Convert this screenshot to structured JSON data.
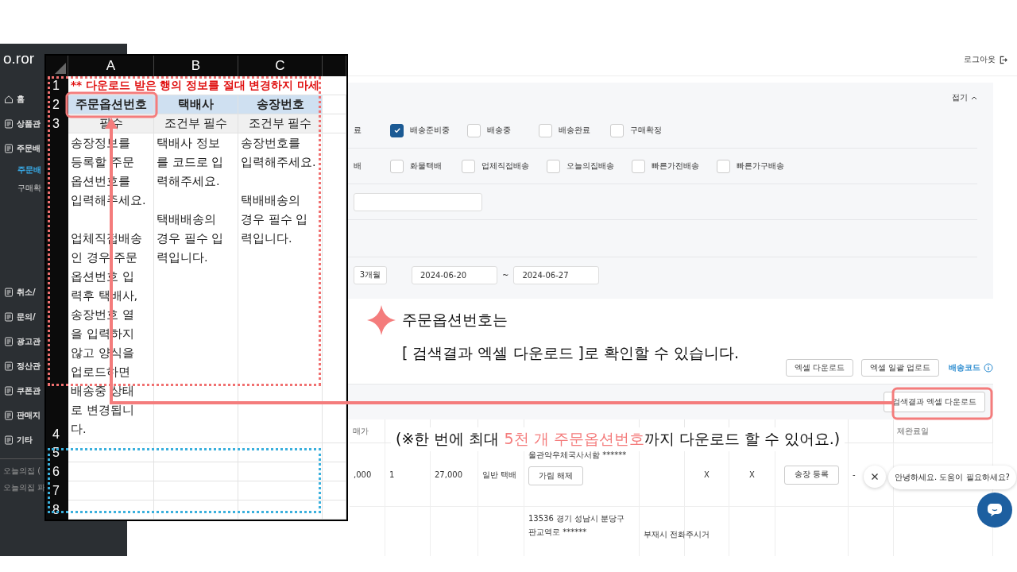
{
  "sidebar": {
    "logo": "o.ror",
    "items": [
      {
        "label": "홈",
        "kind": "home"
      },
      {
        "label": "상품관",
        "kind": "menu"
      },
      {
        "label": "주문배",
        "kind": "menu",
        "children": [
          {
            "label": "주문배",
            "selected": true
          },
          {
            "label": "구매확",
            "selected": false
          }
        ]
      }
    ],
    "more_items": [
      {
        "label": "취소/",
        "kind": "menu"
      },
      {
        "label": "문의/",
        "kind": "menu"
      },
      {
        "label": "광고관",
        "kind": "menu"
      },
      {
        "label": "정산관",
        "kind": "menu"
      },
      {
        "label": "쿠폰관",
        "kind": "menu"
      },
      {
        "label": "판매지",
        "kind": "menu"
      },
      {
        "label": "기타",
        "kind": "menu"
      }
    ],
    "footer_links": [
      "오늘의집 (",
      "오늘의집 파"
    ]
  },
  "header": {
    "logout": "로그아웃"
  },
  "filters": {
    "collapse": "접기",
    "status_row": {
      "label_fragment": "료",
      "options": [
        {
          "label": "배송준비중",
          "checked": true
        },
        {
          "label": "배송중",
          "checked": false
        },
        {
          "label": "배송완료",
          "checked": false
        },
        {
          "label": "구매확정",
          "checked": false
        }
      ]
    },
    "delivery_row": {
      "label_fragment": "배",
      "options": [
        {
          "label": "화물택배",
          "checked": false
        },
        {
          "label": "업체직접배송",
          "checked": false
        },
        {
          "label": "오늘의집배송",
          "checked": false
        },
        {
          "label": "빠른가전배송",
          "checked": false
        },
        {
          "label": "빠른가구배송",
          "checked": false
        }
      ]
    },
    "period": {
      "preset": "3개월",
      "start": "2024-06-20",
      "separator": "~",
      "end": "2024-06-27"
    }
  },
  "actions": {
    "buttons": [
      "엑셀 다운로드",
      "엑셀 일괄 업로드"
    ],
    "code_link": "배송코드"
  },
  "export_button": "검색결과 엑셀 다운로드",
  "table": {
    "columns": {
      "first": "매가",
      "last": "제완료일"
    },
    "rows": [
      {
        "cells": [
          ",000",
          "1",
          "27,000",
          "일반 택배"
        ],
        "address": "울관악우체국사서함 ******",
        "unmask_button": "가림 해제",
        "flags": [
          "X",
          "X"
        ],
        "invoice_button": "송장 등록",
        "dash": "-"
      },
      {
        "address": "13536 경기 성남시 분당구 판교역로 ******",
        "memo": "부재시 전화주시거"
      }
    ]
  },
  "chat": {
    "message": "안녕하세요. 도움이 필요하세요?"
  },
  "spreadsheet": {
    "column_headers": [
      "A",
      "B",
      "C"
    ],
    "row_numbers": [
      "1",
      "2",
      "3",
      "4",
      "5",
      "6",
      "7",
      "8"
    ],
    "notice": "** 다운로드 받은 행의 정보를 절대 변경하지 마세",
    "header_cells": [
      "주문옵션번호",
      "택배사",
      "송장번호"
    ],
    "requirement_cells": [
      "필수",
      "조건부 필수",
      "조건부 필수"
    ],
    "description_cells": [
      "송장정보를\n등록할 주문\n옵션번호를\n입력해주세요.\n\n업체직접배송\n인 경우 주문\n옵션번호 입\n력후 택배사,\n송장번호 열\n을 입력하지\n않고 양식을\n업로드하면\n배송중 상태\n로 변경됩니\n다.",
      "택배사 정보\n를 코드로 입\n력해주세요.\n\n택배배송의\n경우 필수 입\n력입니다.",
      "송장번호를\n입력해주세요.\n\n택배배송의\n경우 필수 입\n력입니다."
    ]
  },
  "callouts": {
    "title": "주문옵션번호는",
    "subtitle": "[ 검색결과 엑셀 다운로드 ]로 확인할 수 있습니다.",
    "note": "(※한 번에 최대 **5천 개 주문옵션번호**까지 다운로드 할 수 있어요.)"
  }
}
